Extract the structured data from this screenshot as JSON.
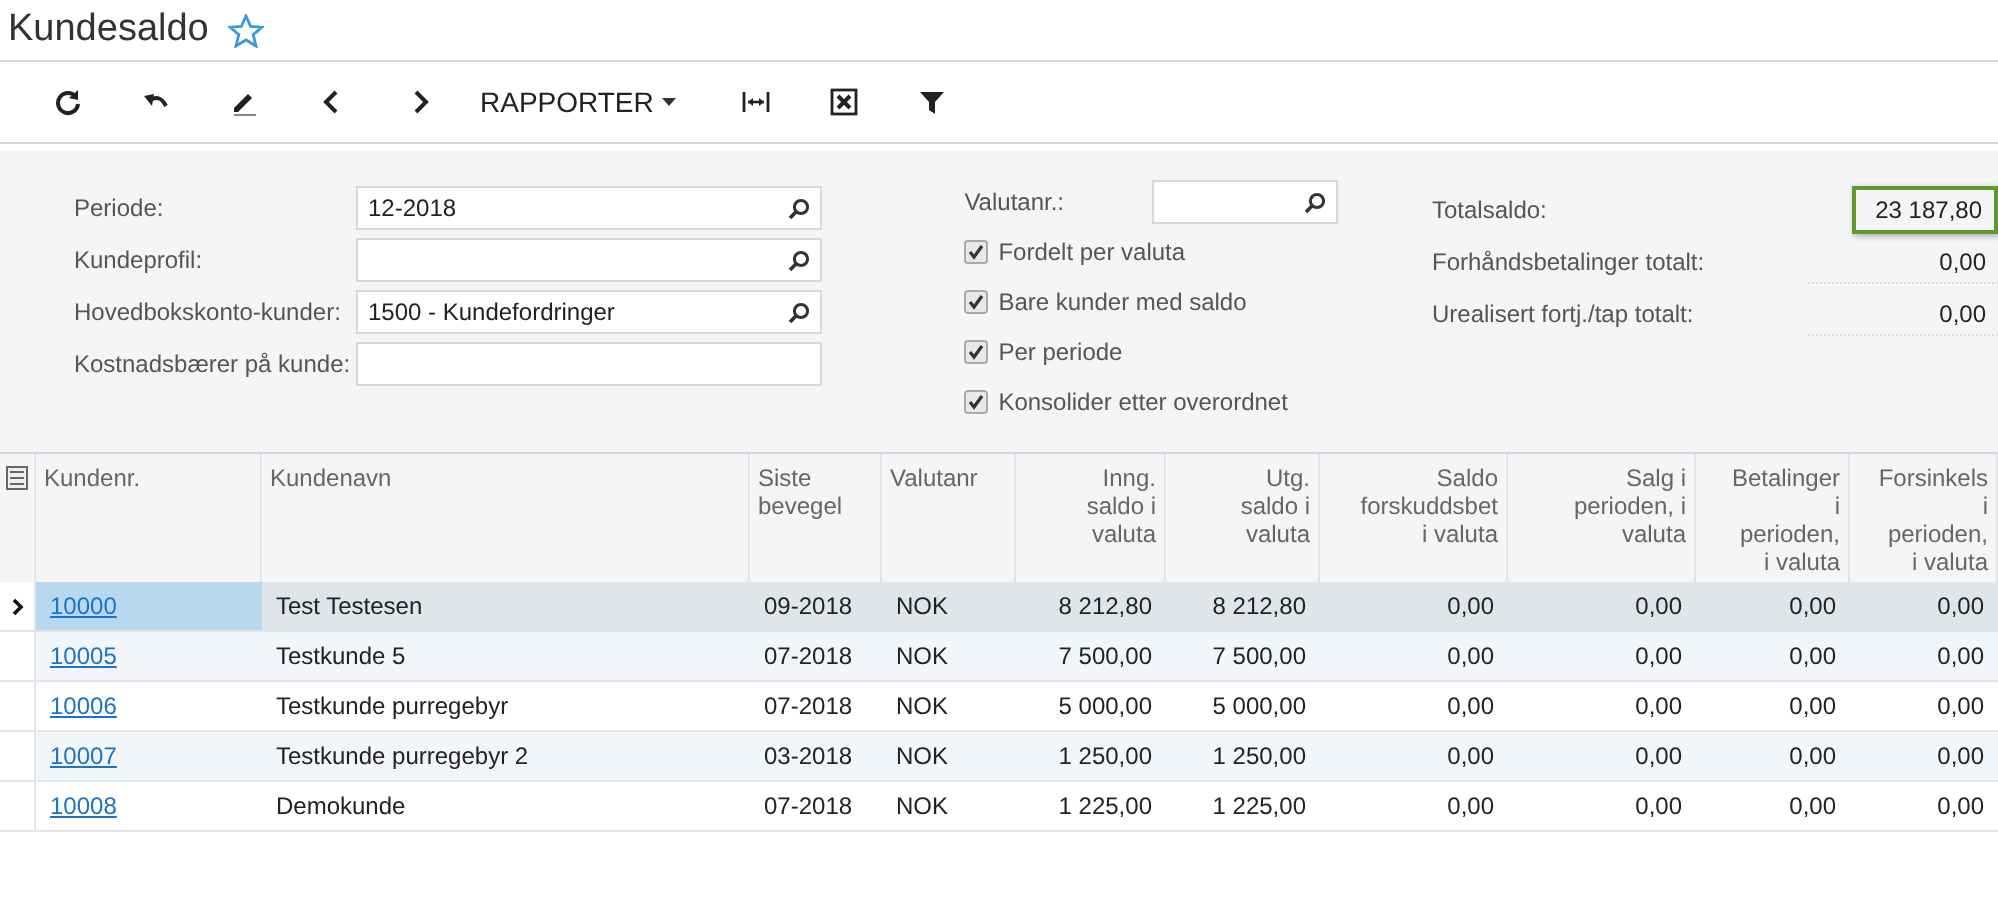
{
  "window": {
    "title": "Kundesaldo",
    "favorite": false
  },
  "toolbar": {
    "reports_menu": "RAPPORTER"
  },
  "filters": {
    "fields": [
      {
        "label": "Periode:",
        "value": "12-2018",
        "kind": "lookup"
      },
      {
        "label": "Kundeprofil:",
        "kind": "lookup"
      },
      {
        "label": "Hovedbokskonto-kunder:",
        "value": "1500 - Kundefordringer",
        "kind": "lookup"
      },
      {
        "label": "Kostnadsbærer på kunde:",
        "kind": "text"
      }
    ],
    "currency_field": {
      "label": "Valutanr.:",
      "kind": "lookup"
    },
    "checkboxes": [
      {
        "label": "Fordelt per valuta",
        "checked": true
      },
      {
        "label": "Bare kunder med saldo",
        "checked": true
      },
      {
        "label": "Per periode",
        "checked": true
      },
      {
        "label": "Konsolider etter overordnet",
        "checked": true
      }
    ],
    "totals": [
      {
        "label": "Totalsaldo:",
        "value": "23 187,80",
        "highlighted": true
      },
      {
        "label": "Forhåndsbetalinger totalt:",
        "value": "0,00",
        "highlighted": false
      },
      {
        "label": "Urealisert fortj./tap totalt:",
        "value": "0,00",
        "highlighted": false
      }
    ]
  },
  "table": {
    "columns": [
      {
        "label": "Kundenr.",
        "numeric": false
      },
      {
        "label": "Kundenavn",
        "numeric": false
      },
      {
        "label": "Siste\nbevegel",
        "numeric": false
      },
      {
        "label": "Valutanr",
        "numeric": false
      },
      {
        "label": "Inng.\nsaldo i\nvaluta",
        "numeric": true
      },
      {
        "label": "Utg.\nsaldo i\nvaluta",
        "numeric": true
      },
      {
        "label": "Saldo\nforskuddsbet\ni valuta",
        "numeric": true
      },
      {
        "label": "Salg i\nperioden, i\nvaluta",
        "numeric": true
      },
      {
        "label": "Betalinger\ni\nperioden,\ni valuta",
        "numeric": true
      },
      {
        "label": "Forsinkels\ni\nperioden,\ni valuta",
        "numeric": true
      }
    ],
    "rows": [
      {
        "selected": true,
        "cells": [
          "10000",
          "Test Testesen",
          "09-2018",
          "NOK",
          "8 212,80",
          "8 212,80",
          "0,00",
          "0,00",
          "0,00",
          "0,00"
        ]
      },
      {
        "selected": false,
        "cells": [
          "10005",
          "Testkunde 5",
          "07-2018",
          "NOK",
          "7 500,00",
          "7 500,00",
          "0,00",
          "0,00",
          "0,00",
          "0,00"
        ]
      },
      {
        "selected": false,
        "cells": [
          "10006",
          "Testkunde purregebyr",
          "07-2018",
          "NOK",
          "5 000,00",
          "5 000,00",
          "0,00",
          "0,00",
          "0,00",
          "0,00"
        ]
      },
      {
        "selected": false,
        "cells": [
          "10007",
          "Testkunde purregebyr 2",
          "03-2018",
          "NOK",
          "1 250,00",
          "1 250,00",
          "0,00",
          "0,00",
          "0,00",
          "0,00"
        ]
      },
      {
        "selected": false,
        "cells": [
          "10008",
          "Demokunde",
          "07-2018",
          "NOK",
          "1 225,00",
          "1 225,00",
          "0,00",
          "0,00",
          "0,00",
          "0,00"
        ]
      }
    ]
  }
}
